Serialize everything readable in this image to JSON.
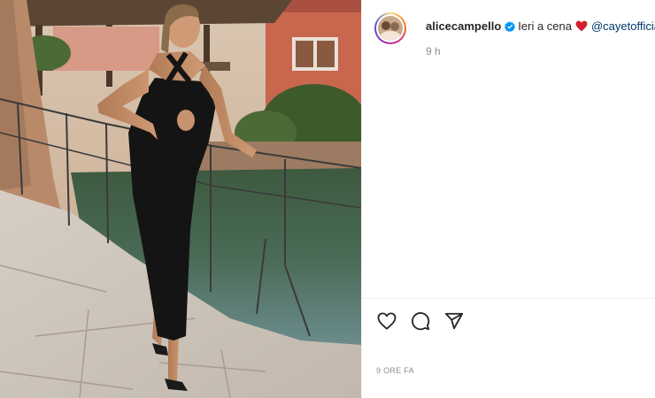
{
  "post": {
    "image_alt": "",
    "author": {
      "username": "alicecampello",
      "verified": true,
      "avatar_icon": "avatar-photo"
    },
    "caption": {
      "text": "Ieri a cena",
      "emoji": "red-heart",
      "mention": "@cayetofficial"
    },
    "time_ago": "9 h",
    "actions": {
      "like_icon": "heart-outline-icon",
      "comment_icon": "comment-icon",
      "share_icon": "paper-plane-icon"
    },
    "date_label": "9 ORE FA"
  },
  "colors": {
    "verified_blue": "#0095f6",
    "mention_blue": "#00376b",
    "heart_red": "#ed4956",
    "muted_text": "#8e8e8e"
  }
}
